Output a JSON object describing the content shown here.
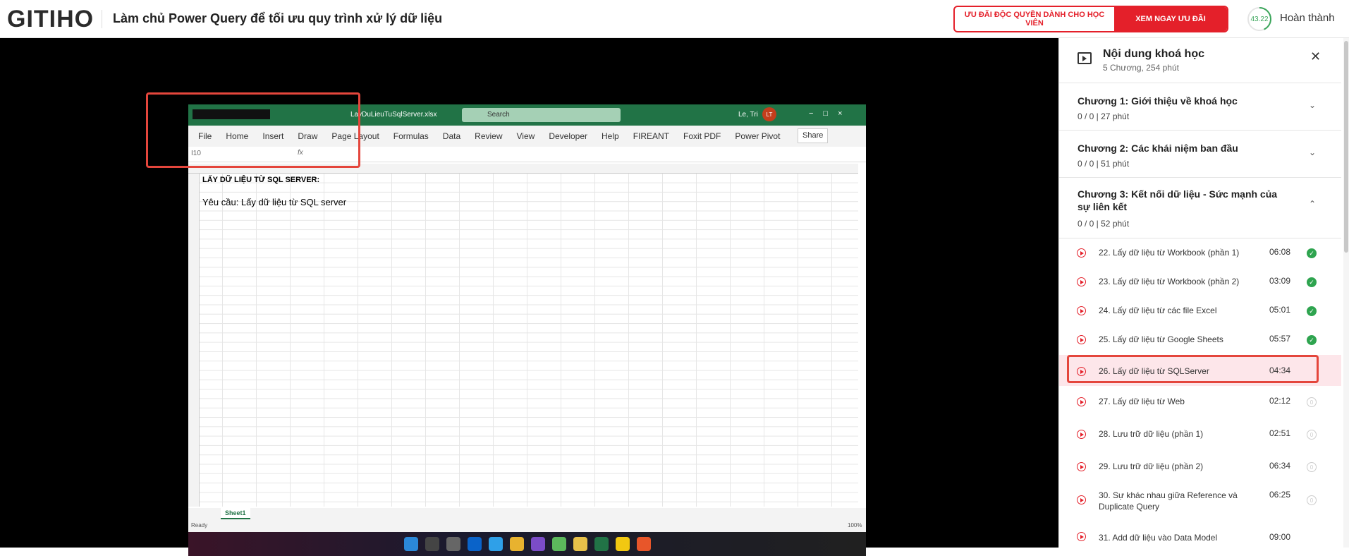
{
  "header": {
    "logo": "GITIHO",
    "course_title": "Làm chủ Power Query để tối ưu quy trình xử lý dữ liệu",
    "promo_text": "ƯU ĐÃI ĐỘC QUYỀN DÀNH CHO HỌC VIÊN",
    "promo_button": "XEM NGAY ƯU ĐÃI",
    "progress_value": "43.22",
    "done_label": "Hoàn thành"
  },
  "excel": {
    "filename": "LayDuLieuTuSqlServer.xlsx",
    "search_placeholder": "Search",
    "user": "Le, Tri",
    "avatar_initials": "LT",
    "menu": [
      "File",
      "Home",
      "Insert",
      "Draw",
      "Page Layout",
      "Formulas",
      "Data",
      "Review",
      "View",
      "Developer",
      "Help",
      "FIREANT",
      "Foxit PDF",
      "Power Pivot"
    ],
    "share": "Share",
    "name_box": "I10",
    "cell_a1": "LẤY DỮ LIỆU TỪ SQL SERVER:",
    "cell_a3": "Yêu cầu:  Lấy dữ liệu từ SQL server",
    "sheet_tab": "Sheet1",
    "status": "Ready",
    "zoom": "100%"
  },
  "sidebar": {
    "title": "Nội dung khoá học",
    "subtitle": "5 Chương, 254 phút",
    "chapters": [
      {
        "title": "Chương 1: Giới thiệu về khoá học",
        "meta": "0 / 0   |   27 phút"
      },
      {
        "title": "Chương 2: Các khái niệm ban đầu",
        "meta": "0 / 0   |   51 phút"
      },
      {
        "title": "Chương 3: Kết nối dữ liệu - Sức mạnh của sự liên kết",
        "meta": "0 / 0   |   52 phút"
      }
    ],
    "lessons": [
      {
        "title": "22. Lấy dữ liệu từ Workbook (phần 1)",
        "duration": "06:08",
        "done": true
      },
      {
        "title": "23. Lấy dữ liệu từ Workbook (phần 2)",
        "duration": "03:09",
        "done": true
      },
      {
        "title": "24. Lấy dữ liệu từ các file Excel",
        "duration": "05:01",
        "done": true
      },
      {
        "title": "25. Lấy dữ liệu từ Google Sheets",
        "duration": "05:57",
        "done": true
      },
      {
        "title": "26. Lấy dữ liệu từ SQLServer",
        "duration": "04:34",
        "done": false
      },
      {
        "title": "27. Lấy dữ liệu từ Web",
        "duration": "02:12",
        "done": false
      },
      {
        "title": "28. Lưu trữ dữ liệu (phần 1)",
        "duration": "02:51",
        "done": false
      },
      {
        "title": "29. Lưu trữ dữ liệu (phần 2)",
        "duration": "06:34",
        "done": false
      },
      {
        "title": "30. Sự khác nhau giữa Reference và Duplicate Query",
        "duration": "06:25",
        "done": false
      },
      {
        "title": "31. Add dữ liệu vào Data Model",
        "duration": "09:00",
        "done": false
      }
    ],
    "ring_placeholder": "0"
  }
}
